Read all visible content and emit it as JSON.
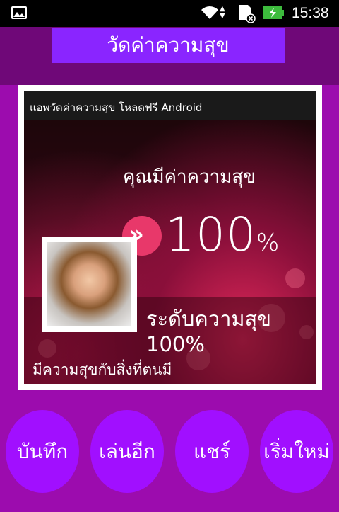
{
  "status_bar": {
    "time": "15:38",
    "icons": [
      "image-icon",
      "wifi-icon",
      "data-arrows-icon",
      "sd-card-icon",
      "battery-charging-icon"
    ]
  },
  "app": {
    "title": "วัดค่าความสุข"
  },
  "result": {
    "caption": "แอพวัดค่าความสุข โหลดฟรี Android",
    "heading": "คุณมีค่าความสุข",
    "percent_value": "100",
    "percent_sign": "%",
    "level_line1": "ระดับความสุข",
    "level_line2": "100%",
    "message": "มีความสุขกับสิ่งที่ตนมี"
  },
  "actions": {
    "save": "บันทึก",
    "play_again": "เล่นอีก",
    "share": "แชร์",
    "restart": "เริ่มใหม่"
  },
  "colors": {
    "background": "#9c0cae",
    "header_band": "#6f0878",
    "title_bar": "#8a25ff",
    "button": "#a10fff",
    "badge": "#e8386a"
  }
}
